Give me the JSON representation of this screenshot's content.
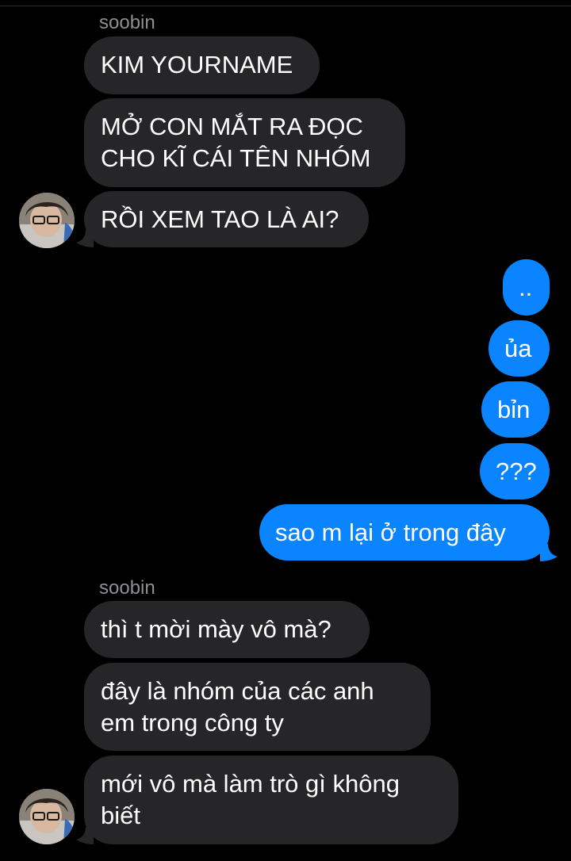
{
  "colors": {
    "background": "#000000",
    "incoming_bubble": "#262628",
    "outgoing_bubble": "#0a84ff",
    "sender_name": "#8e8e93"
  },
  "thread": {
    "group1": {
      "sender": "soobin",
      "messages": [
        "KIM YOURNAME",
        "MỞ CON MẮT RA ĐỌC\nCHO KĨ CÁI TÊN NHÓM",
        "RỒI XEM TAO LÀ AI?"
      ],
      "avatar_icon": "profile-photo"
    },
    "outgoing": {
      "messages": [
        "..",
        "ủa",
        "bỉn",
        "???",
        "sao m lại ở trong đây"
      ]
    },
    "group2": {
      "sender": "soobin",
      "messages": [
        "thì t mời mày vô mà?",
        "đây là nhóm của các anh\nem trong công ty",
        "mới vô mà làm trò gì không\nbiết"
      ],
      "avatar_icon": "profile-photo"
    }
  }
}
